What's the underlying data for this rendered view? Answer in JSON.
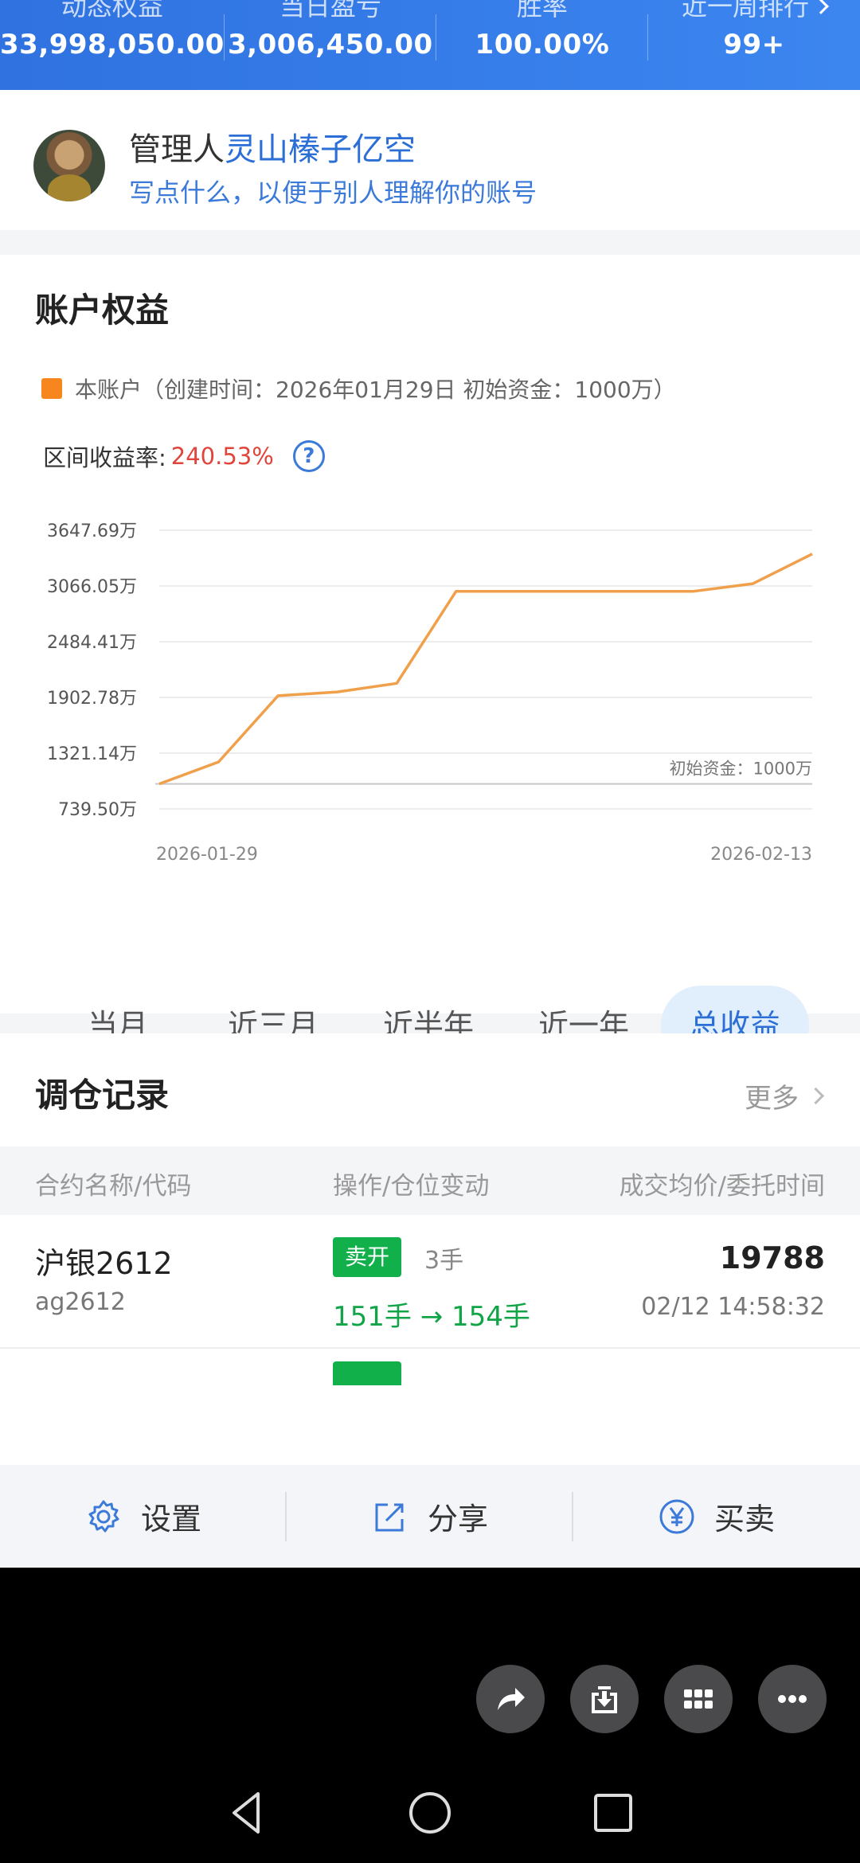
{
  "stats": [
    {
      "label": "动态权益",
      "value": "33,998,050.00"
    },
    {
      "label": "当日盈亏",
      "value": "3,006,450.00"
    },
    {
      "label": "胜率",
      "value": "100.00%"
    },
    {
      "label": "近一周排行",
      "value": "99+"
    }
  ],
  "manager": {
    "prefix": "管理人",
    "name": "灵山榛子亿空",
    "bio": "写点什么，以便于别人理解你的账号"
  },
  "equity": {
    "title": "账户权益",
    "legend": "本账户（创建时间：2026年01月29日 初始资金：1000万）",
    "return_label": "区间收益率:",
    "return_value": "240.53%",
    "help": "?",
    "baseline_label": "初始资金：1000万"
  },
  "chart_data": {
    "type": "line",
    "x": [
      "2026-01-29",
      "2026-01-30",
      "2026-02-02",
      "2026-02-03",
      "2026-02-04",
      "2026-02-05",
      "2026-02-06",
      "2026-02-09",
      "2026-02-10",
      "2026-02-11",
      "2026-02-12",
      "2026-02-13"
    ],
    "series": [
      {
        "values": [
          1000,
          1230,
          1920,
          1960,
          2050,
          3010,
          3010,
          3010,
          3010,
          3010,
          3090,
          3400
        ]
      }
    ],
    "ytick_labels": [
      "3647.69万",
      "3066.05万",
      "2484.41万",
      "1902.78万",
      "1321.14万",
      "739.50万"
    ],
    "yticks": [
      3647.69,
      3066.05,
      2484.41,
      1902.78,
      1321.14,
      739.5
    ],
    "ylim": [
      739.5,
      3647.69
    ],
    "xtick_labels": [
      "2026-01-29",
      "2026-02-13"
    ],
    "baseline": 1000,
    "color": "#f0a04b",
    "grid": true
  },
  "periods": [
    "当月",
    "近三月",
    "近半年",
    "近一年",
    "总收益"
  ],
  "active_period": "总收益",
  "trades": {
    "title": "调仓记录",
    "more": "更多",
    "headers": [
      "合约名称/代码",
      "操作/仓位变动",
      "成交均价/委托时间"
    ],
    "rows": [
      {
        "name": "沪银2612",
        "code": "ag2612",
        "action": "卖开",
        "qty": "3手",
        "from": "151手",
        "to": "154手",
        "price": "19788",
        "time": "02/12 14:58:32"
      }
    ]
  },
  "bottom": {
    "settings": "设置",
    "share": "分享",
    "trade": "买卖"
  },
  "fabs": [
    "share-arrow-icon",
    "download-icon",
    "grid-apps-icon",
    "more-dots-icon"
  ],
  "accent": "#2f72e0",
  "up_color": "#e0443a",
  "down_color": "#12b04a"
}
